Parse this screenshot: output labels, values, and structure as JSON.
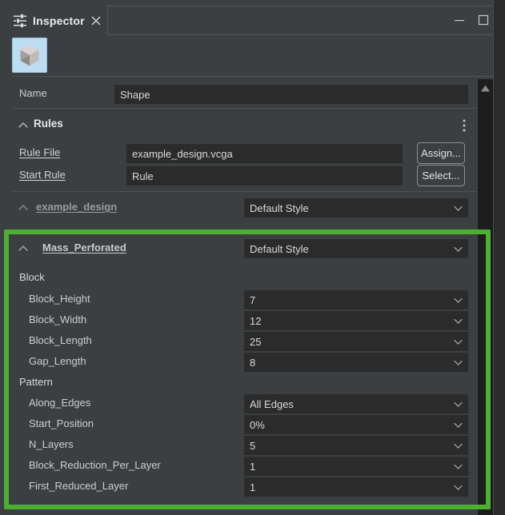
{
  "window": {
    "tab_label": "Inspector",
    "tab_icon": "sliders-icon",
    "close_icon": "close-icon",
    "minimize_icon": "minimize-icon",
    "maximize_icon": "maximize-icon"
  },
  "toolbar": {
    "cube_icon": "cube-icon"
  },
  "name_row": {
    "label": "Name",
    "value": "Shape"
  },
  "rules": {
    "title": "Rules",
    "collapse_icon": "chevron-up-icon",
    "menu_icon": "kebab-menu-icon",
    "rule_file": {
      "label": "Rule File",
      "value": "example_design.vcga",
      "button": "Assign..."
    },
    "start_rule": {
      "label": "Start Rule",
      "value": "Rule",
      "button": "Select..."
    }
  },
  "styles": [
    {
      "name": "example_design",
      "style": "Default Style",
      "collapse_icon": "chevron-up-icon",
      "dim": true
    },
    {
      "name": "Mass_Perforated",
      "style": "Default Style",
      "collapse_icon": "chevron-up-icon",
      "dim": false
    }
  ],
  "groups": [
    {
      "title": "Block",
      "params": [
        {
          "label": "Block_Height",
          "value": "7"
        },
        {
          "label": "Block_Width",
          "value": "12"
        },
        {
          "label": "Block_Length",
          "value": "25"
        },
        {
          "label": "Gap_Length",
          "value": "8"
        }
      ]
    },
    {
      "title": "Pattern",
      "params": [
        {
          "label": "Along_Edges",
          "value": "All Edges"
        },
        {
          "label": "Start_Position",
          "value": "0%"
        },
        {
          "label": "N_Layers",
          "value": "5"
        },
        {
          "label": "Block_Reduction_Per_Layer",
          "value": "1"
        },
        {
          "label": "First_Reduced_Layer",
          "value": "1"
        }
      ]
    }
  ],
  "scrollbar": {
    "up_icon": "scroll-up-arrow-icon"
  },
  "highlight": {
    "color": "#4caf32",
    "label": "highlight-rectangle"
  }
}
